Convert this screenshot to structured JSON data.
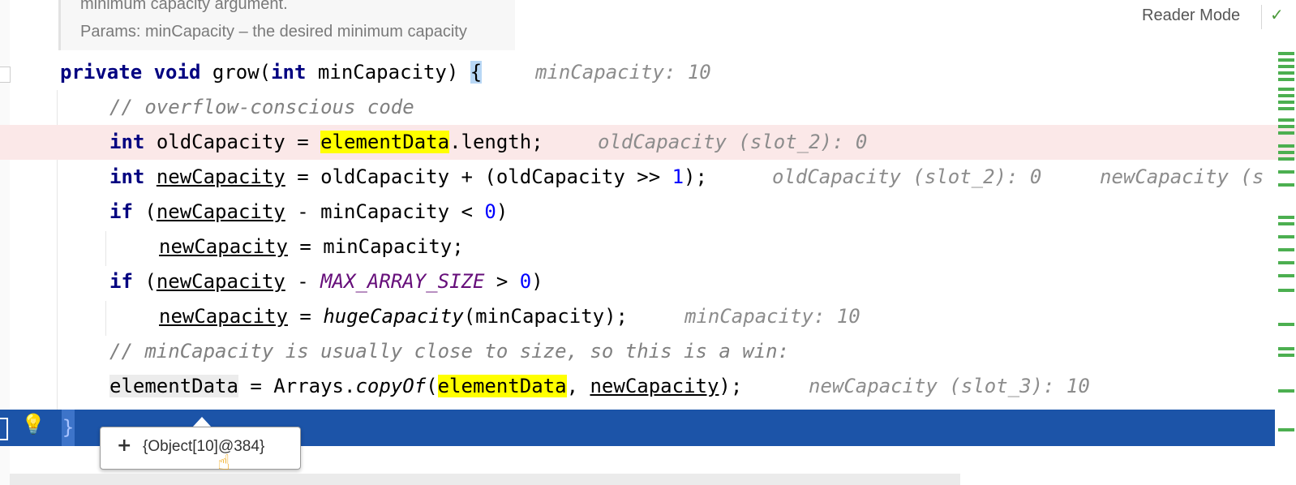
{
  "doc": {
    "line1": "minimum capacity argument.",
    "line2": "Params: minCapacity – the desired minimum capacity"
  },
  "toolbar": {
    "reader_mode": "Reader Mode",
    "check_glyph": "✓"
  },
  "code": {
    "l1": {
      "kw1": "private",
      "kw2": "void",
      "name": "grow(",
      "kw3": "int",
      "param": "minCapacity)",
      "brace": "{",
      "hint": "minCapacity: 10"
    },
    "l2": {
      "comment": "// overflow-conscious code"
    },
    "l3": {
      "kw": "int",
      "pre": "oldCapacity = ",
      "id": "elementData",
      "post": ".length;",
      "hint": "oldCapacity (slot_2): 0"
    },
    "l4": {
      "kw": "int",
      "var": "newCapacity",
      "mid": "= oldCapacity + (oldCapacity >> ",
      "num": "1",
      "end": ");",
      "hint1": "oldCapacity (slot_2): 0",
      "hint2": "newCapacity (s"
    },
    "l5": {
      "kw": "if",
      "open": "(",
      "var": "newCapacity",
      "mid": "- minCapacity < ",
      "num": "0",
      "end": ")"
    },
    "l6": {
      "var": "newCapacity",
      "rest": "= minCapacity;"
    },
    "l7": {
      "kw": "if",
      "open": "(",
      "var": "newCapacity",
      "op": "- ",
      "const": "MAX_ARRAY_SIZE",
      "mid": " > ",
      "num": "0",
      "end": ")"
    },
    "l8": {
      "var": "newCapacity",
      "eq": "= ",
      "fn": "hugeCapacity",
      "args": "(minCapacity);",
      "hint": "minCapacity: 10"
    },
    "l9": {
      "comment": "// minCapacity is usually close to size, so this is a win:"
    },
    "l10": {
      "id1": "elementData",
      "mid": " = Arrays.",
      "fn": "copyOf",
      "open": "(",
      "id2": "elementData",
      "sep": ", ",
      "var": "newCapacity",
      "end": ");",
      "hint": "newCapacity (slot_3): 10"
    },
    "l11": {
      "brace": "}"
    }
  },
  "popup": {
    "plus": "+",
    "value": "{Object[10]@384}"
  },
  "icons": {
    "bulb": "lightbulb-icon",
    "hand": "hand-cursor-icon",
    "check": "checkmark-icon",
    "plus": "plus-icon"
  }
}
